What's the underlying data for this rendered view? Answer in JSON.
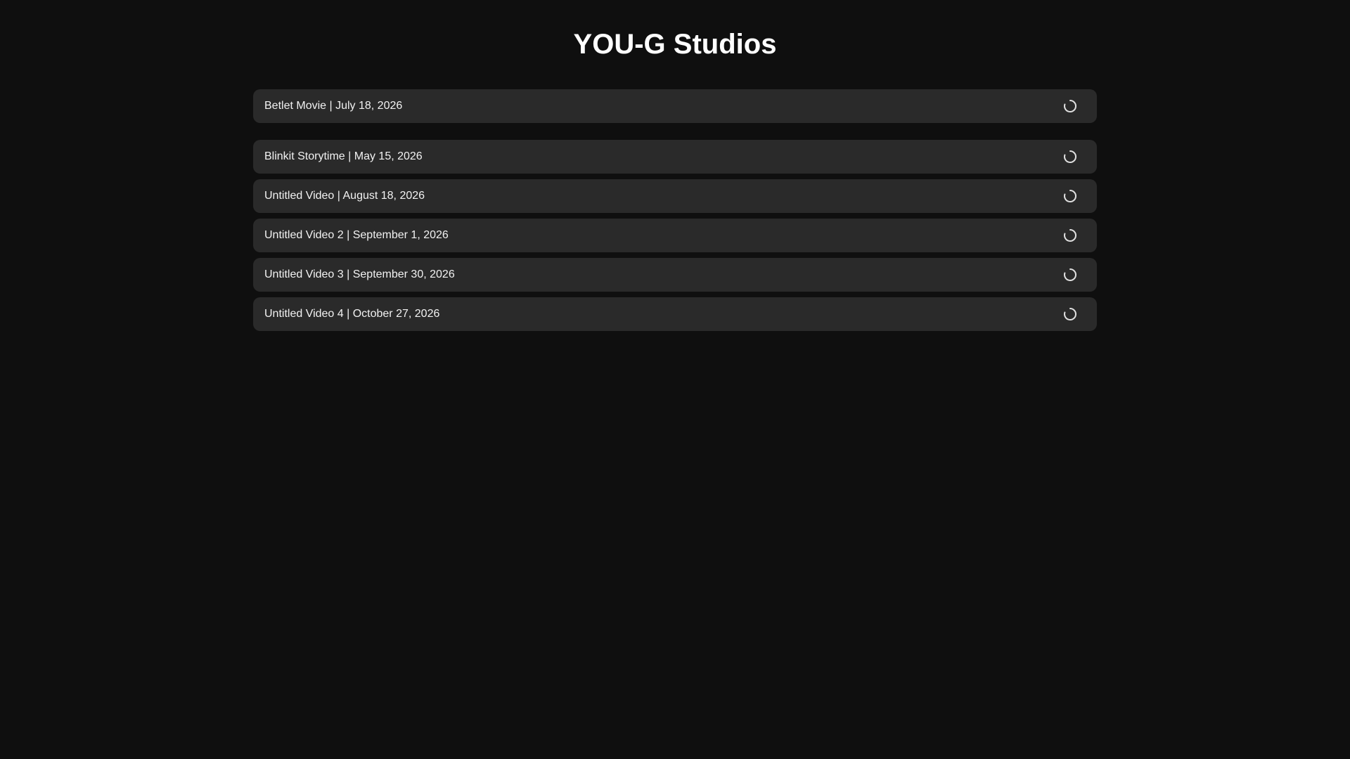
{
  "header": {
    "title": "YOU-G Studios"
  },
  "videos": [
    {
      "label": "Betlet Movie | July 18, 2026",
      "status": "loading"
    },
    {
      "label": "Blinkit Storytime | May 15, 2026",
      "status": "loading"
    },
    {
      "label": "Untitled Video | August 18, 2026",
      "status": "loading"
    },
    {
      "label": "Untitled Video 2 | September 1, 2026",
      "status": "loading"
    },
    {
      "label": "Untitled Video 3 | September 30, 2026",
      "status": "loading"
    },
    {
      "label": "Untitled Video 4 | October 27, 2026",
      "status": "loading"
    }
  ],
  "icons": {
    "status": "loading-spinner-icon"
  },
  "colors": {
    "background": "#0f0f0f",
    "card": "#2a2a2a",
    "text": "#ffffff",
    "spinner": "#e0e0e0"
  }
}
